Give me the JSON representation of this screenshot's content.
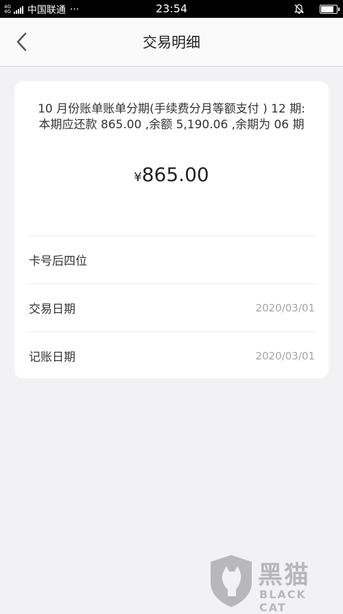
{
  "status_bar": {
    "network_top": "4G",
    "network_bottom": "4G",
    "carrier": "中国联通",
    "more": "···",
    "time": "23:54",
    "battery_level": 0.85
  },
  "nav": {
    "title": "交易明细"
  },
  "transaction": {
    "description": "10 月份账单账单分期(手续费分月等额支付 ) 12 期:本期应还款 865.00 ,余额 5,190.06 ,余期为 06 期",
    "currency_symbol": "¥",
    "amount": "865.00",
    "rows": [
      {
        "label": "卡号后四位",
        "value": ""
      },
      {
        "label": "交易日期",
        "value": "2020/03/01"
      },
      {
        "label": "记账日期",
        "value": "2020/03/01"
      }
    ]
  },
  "watermark": {
    "cn": "黑猫",
    "en": "BLACK CAT"
  }
}
